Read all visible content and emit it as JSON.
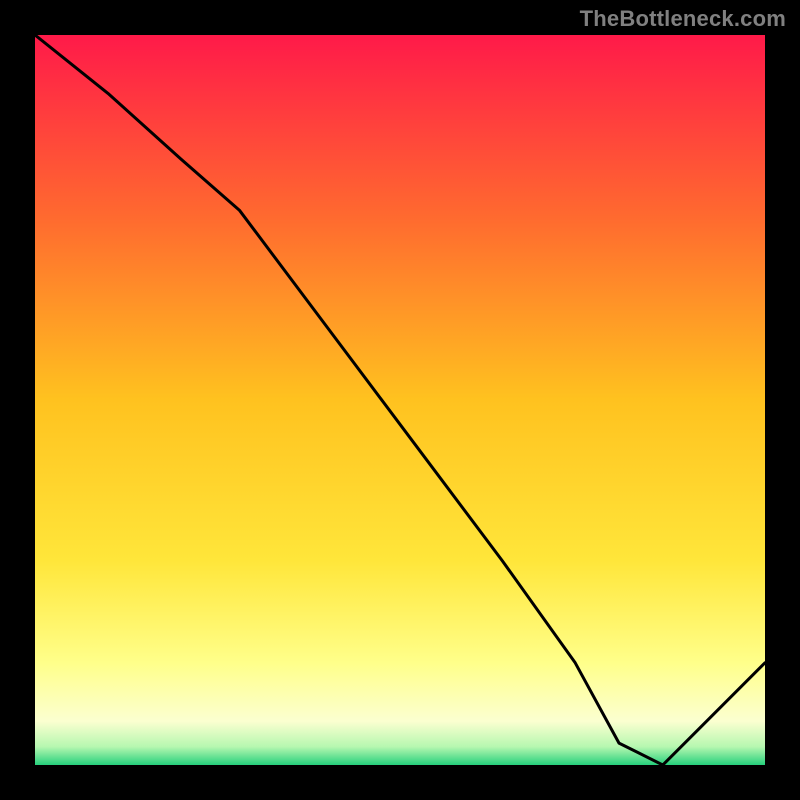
{
  "watermark": "TheBottleneck.com",
  "colors": {
    "frame_border": "#000000",
    "line": "#000000",
    "watermark": "#808080",
    "label": "#d02a20",
    "gradient_stops": [
      {
        "offset": 0.0,
        "color": "#ff1a49"
      },
      {
        "offset": 0.25,
        "color": "#ff6a2f"
      },
      {
        "offset": 0.5,
        "color": "#ffc21f"
      },
      {
        "offset": 0.72,
        "color": "#ffe63a"
      },
      {
        "offset": 0.86,
        "color": "#ffff8a"
      },
      {
        "offset": 0.94,
        "color": "#fbffd0"
      },
      {
        "offset": 0.975,
        "color": "#b6f7b0"
      },
      {
        "offset": 1.0,
        "color": "#26d07c"
      }
    ]
  },
  "bottom_label": {
    "text": "",
    "x_frac": 0.78,
    "y_frac": 0.975
  },
  "chart_data": {
    "type": "line",
    "title": "",
    "xlabel": "",
    "ylabel": "",
    "x_range": [
      0,
      100
    ],
    "y_range": [
      0,
      100
    ],
    "grid": false,
    "legend": false,
    "note": "Axis ticks and labels are not drawn in the source image; x and y are normalized 0–100. The curve is a bottleneck-style V where higher y = worse (red) and 0 = optimal (green). Values estimated visually from the plot.",
    "series": [
      {
        "name": "bottleneck_curve",
        "x": [
          0,
          10,
          20,
          28,
          40,
          52,
          64,
          74,
          80,
          86,
          90,
          100
        ],
        "y": [
          100,
          92,
          83,
          76,
          60,
          44,
          28,
          14,
          3,
          0,
          4,
          14
        ]
      }
    ],
    "optimal_x_range": [
      80,
      89
    ]
  }
}
